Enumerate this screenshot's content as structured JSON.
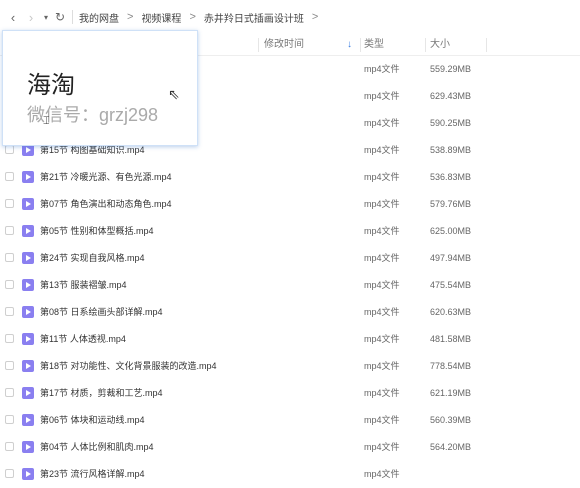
{
  "toolbar": {
    "back_icon": "chevron-left-icon",
    "forward_icon": "chevron-right-icon",
    "history_icon": "caret-down-icon",
    "refresh_icon": "refresh-icon",
    "breadcrumb": [
      "我的网盘",
      "视频课程",
      "赤井羚日式插画设计班"
    ]
  },
  "columns": {
    "modified": "修改时间",
    "type": "类型",
    "size": "大小",
    "sort_icon": "sort-down-icon"
  },
  "files": [
    {
      "name": "",
      "type": "mp4文件",
      "size": "559.29MB"
    },
    {
      "name": "",
      "type": "mp4文件",
      "size": "629.43MB"
    },
    {
      "name": "",
      "type": "mp4文件",
      "size": "590.25MB"
    },
    {
      "name": "第15节 构图基础知识.mp4",
      "type": "mp4文件",
      "size": "538.89MB"
    },
    {
      "name": "第21节 冷暖光源、有色光源.mp4",
      "type": "mp4文件",
      "size": "536.83MB"
    },
    {
      "name": "第07节 角色演出和动态角色.mp4",
      "type": "mp4文件",
      "size": "579.76MB"
    },
    {
      "name": "第05节 性别和体型概括.mp4",
      "type": "mp4文件",
      "size": "625.00MB"
    },
    {
      "name": "第24节 实现自我风格.mp4",
      "type": "mp4文件",
      "size": "497.94MB"
    },
    {
      "name": "第13节 服装褶皱.mp4",
      "type": "mp4文件",
      "size": "475.54MB"
    },
    {
      "name": "第08节 日系绘画头部详解.mp4",
      "type": "mp4文件",
      "size": "620.63MB"
    },
    {
      "name": "第11节 人体透视.mp4",
      "type": "mp4文件",
      "size": "481.58MB"
    },
    {
      "name": "第18节 对功能性、文化背景服装的改造.mp4",
      "type": "mp4文件",
      "size": "778.54MB"
    },
    {
      "name": "第17节 材质，剪裁和工艺.mp4",
      "type": "mp4文件",
      "size": "621.19MB"
    },
    {
      "name": "第06节 体块和运动线.mp4",
      "type": "mp4文件",
      "size": "560.39MB"
    },
    {
      "name": "第04节 人体比例和肌肉.mp4",
      "type": "mp4文件",
      "size": "564.20MB"
    },
    {
      "name": "第23节 流行风格详解.mp4",
      "type": "mp4文件",
      "size": ""
    }
  ],
  "popup": {
    "title": "海淘",
    "subtitle": "微信号：grzj298"
  },
  "colors": {
    "accent": "#3b7de0",
    "file_icon": "#8a7ff0"
  }
}
